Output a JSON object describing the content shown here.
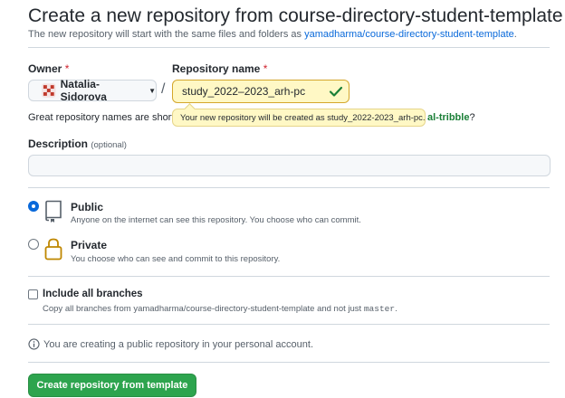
{
  "header": {
    "title": "Create a new repository from course-directory-student-template",
    "subtitle_prefix": "The new repository will start with the same files and folders as ",
    "template_link": "yamadharma/course-directory-student-template",
    "subtitle_suffix": "."
  },
  "owner": {
    "label": "Owner",
    "required_mark": "*",
    "value": "Natalia-Sidorova"
  },
  "repo": {
    "label": "Repository name",
    "required_mark": "*",
    "value": "study_2022–2023_arh-pc",
    "separator": "/",
    "tooltip": "Your new repository will be created as study_2022-2023_arh-pc."
  },
  "names_hint": {
    "text": "Great repository names are short",
    "suggestion": "al-tribble",
    "suffix": "?"
  },
  "description": {
    "label": "Description",
    "optional": "(optional)",
    "value": ""
  },
  "visibility": {
    "selected": "public",
    "public": {
      "title": "Public",
      "desc": "Anyone on the internet can see this repository. You choose who can commit."
    },
    "private": {
      "title": "Private",
      "desc": "You choose who can see and commit to this repository."
    }
  },
  "branches": {
    "label": "Include all branches",
    "desc_prefix": "Copy all branches from yamadharma/course-directory-student-template and not just ",
    "desc_code": "master",
    "desc_suffix": "."
  },
  "info": {
    "text": "You are creating a public repository in your personal account."
  },
  "submit": {
    "label": "Create repository from template"
  },
  "colors": {
    "accent": "#0969da",
    "primary_button": "#2da44e",
    "tooltip_bg": "#fff8c5",
    "success": "#1a7f37"
  }
}
